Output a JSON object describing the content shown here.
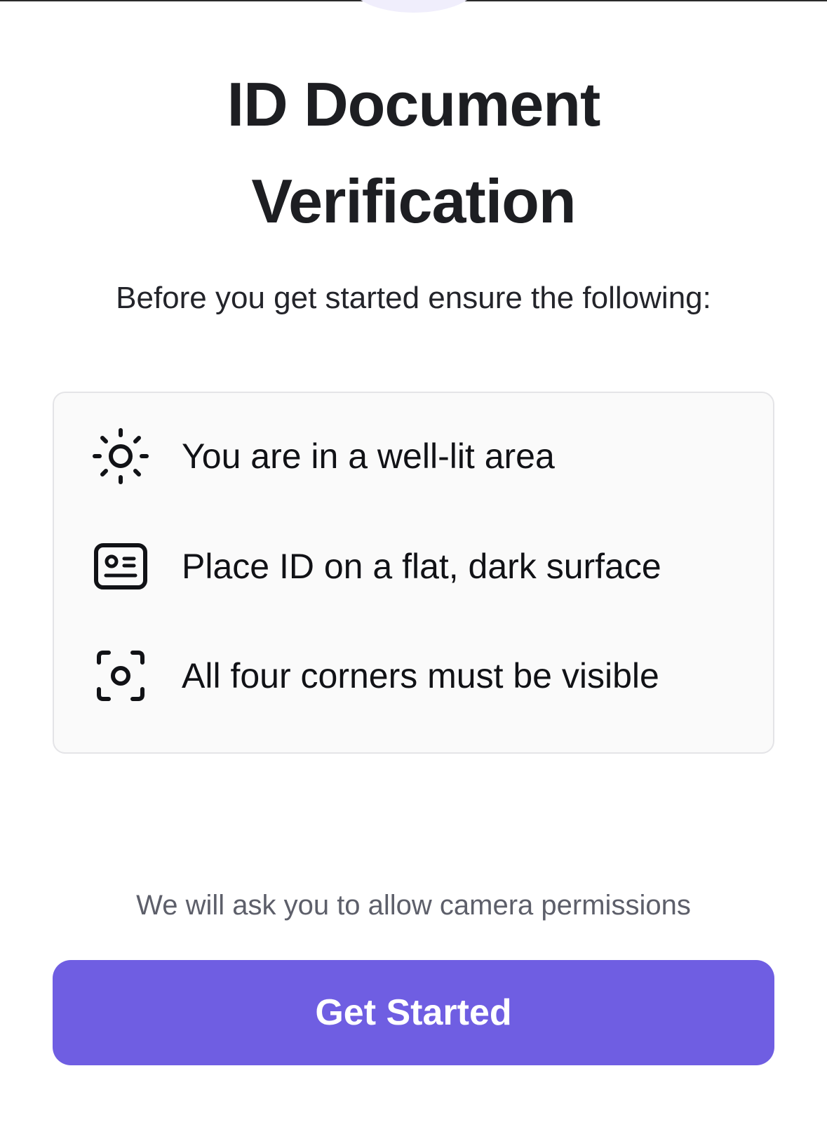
{
  "header": {
    "title_line1": "ID Document",
    "title_line2": "Verification",
    "subtitle": "Before you get started ensure the following:"
  },
  "checklist": {
    "items": [
      {
        "icon": "sun-icon",
        "label": "You are in a well-lit area"
      },
      {
        "icon": "id-card-icon",
        "label": "Place ID on a flat, dark surface"
      },
      {
        "icon": "focus-scan-icon",
        "label": "All four corners must be visible"
      }
    ]
  },
  "footer": {
    "permission_note": "We will ask you to allow camera permissions",
    "cta_label": "Get Started"
  },
  "colors": {
    "accent": "#6f5ee2",
    "text_primary": "#1d1e22",
    "text_muted": "#5d5f6a",
    "card_background": "#fafafa",
    "card_border": "#e4e4e7"
  }
}
